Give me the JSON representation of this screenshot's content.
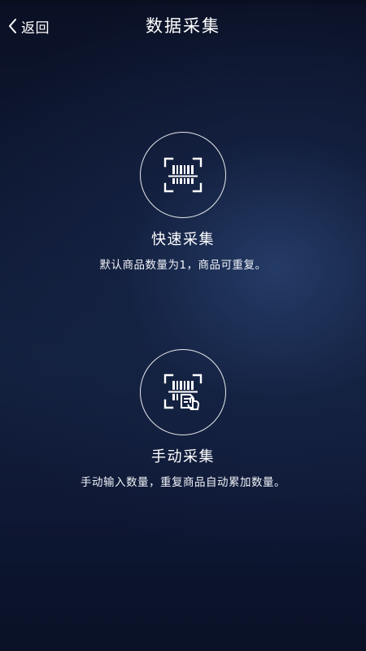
{
  "header": {
    "back_label": "返回",
    "title": "数据采集"
  },
  "options": [
    {
      "title": "快速采集",
      "description": "默认商品数量为1，商品可重复。",
      "icon": "barcode-scan-icon"
    },
    {
      "title": "手动采集",
      "description": "手动输入数量，重复商品自动累加数量。",
      "icon": "barcode-manual-input-icon"
    }
  ],
  "colors": {
    "background_top": "#0a1024",
    "background_center": "#1c2d55",
    "text": "#ffffff"
  }
}
